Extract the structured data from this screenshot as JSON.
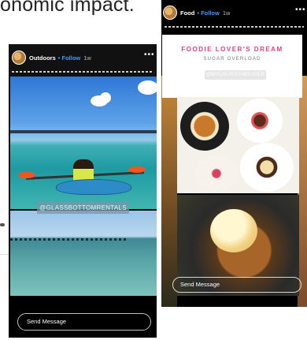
{
  "background": {
    "headline": "onomic impact."
  },
  "story1": {
    "account": "Outdoors",
    "follow_label": "Follow",
    "separator": "•",
    "time": "1w",
    "more": "•••",
    "photo_tag": "@GLASSBOTTOMRENTALS",
    "send_message": "Send Message"
  },
  "story2": {
    "account": "Food",
    "follow_label": "Follow",
    "separator": "•",
    "time": "1w",
    "more": "•••",
    "card_title": "FOODIE LOVER'S DREAM",
    "card_subtitle": "SUGAR OVERLOAD",
    "card_tag": "@MYLOUIESTHEEATER",
    "send_message": "Send Message"
  },
  "colors": {
    "follow": "#3d9bff",
    "title_pink": "#e1417f"
  }
}
